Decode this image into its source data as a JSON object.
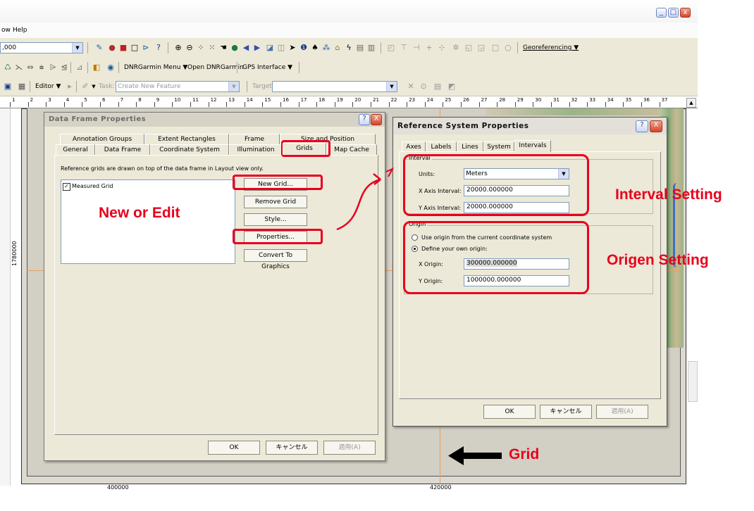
{
  "menu": {
    "items": [
      "ow",
      "Help"
    ]
  },
  "toolbar1": {
    "scale_value": ",000",
    "georeferencing_label": "Georeferencing ▼"
  },
  "toolbar2": {
    "dnr_menu": "DNRGarmin Menu ▼",
    "open_dnr": "Open DNRGarmin",
    "gps_interface": "GPS Interface ▼"
  },
  "toolbar3": {
    "editor_label": "Editor ▼",
    "task_label": "Task:",
    "task_value": "Create New Feature",
    "target_label": "Target:"
  },
  "ruler": {
    "ticks": [
      "1",
      "2",
      "3",
      "4",
      "5",
      "6",
      "7",
      "8",
      "9",
      "10",
      "11",
      "12",
      "13",
      "14",
      "15",
      "16",
      "17",
      "18",
      "19",
      "20",
      "21",
      "22",
      "23",
      "24",
      "25",
      "26",
      "27",
      "28",
      "29",
      "30",
      "31",
      "32",
      "33",
      "34",
      "35",
      "36",
      "37"
    ]
  },
  "map": {
    "y_coord_label": "1780000",
    "x_coord_left": "400000",
    "x_coord_right": "420000"
  },
  "data_frame_dialog": {
    "title": "Data Frame Properties",
    "help_btn": "?",
    "close_btn": "X",
    "tabs_row1": [
      "Annotation Groups",
      "Extent Rectangles",
      "Frame",
      "Size and Position"
    ],
    "tabs_row2": [
      "General",
      "Data Frame",
      "Coordinate System",
      "Illumination",
      "Grids",
      "Map Cache"
    ],
    "description": "Reference grids are drawn on top of the data frame in Layout view only.",
    "grid_list": [
      {
        "label": "Measured Grid",
        "checked": true
      }
    ],
    "buttons": {
      "new_grid": "New Grid...",
      "remove_grid": "Remove Grid",
      "style": "Style...",
      "properties": "Properties...",
      "convert": "Convert To Graphics"
    },
    "footer": {
      "ok": "OK",
      "cancel": "キャンセル",
      "apply": "適用(A)"
    }
  },
  "ref_dialog": {
    "title": "Reference System Properties",
    "help_btn": "?",
    "close_btn": "X",
    "tabs": [
      "Axes",
      "Labels",
      "Lines",
      "System",
      "Intervals"
    ],
    "interval_group": "Interval",
    "units_label": "Units:",
    "units_value": "Meters",
    "x_interval_label": "X Axis Interval:",
    "x_interval_value": "20000.000000",
    "y_interval_label": "Y Axis Interval:",
    "y_interval_value": "20000.000000",
    "origin_group": "Origin",
    "use_origin_label": "Use origin from the current coordinate system",
    "define_origin_label": "Define your own origin:",
    "x_origin_label": "X Origin:",
    "x_origin_value": "300000.000000",
    "y_origin_label": "Y Origin:",
    "y_origin_value": "1000000.000000",
    "footer": {
      "ok": "OK",
      "cancel": "キャンセル",
      "apply": "適用(A)"
    }
  },
  "annotations": {
    "new_or_edit": "New or Edit",
    "interval_setting": "Interval Setting",
    "origin_setting": "Origen Setting",
    "grid": "Grid"
  },
  "colors": {
    "highlight_red": "#e8001c",
    "dialog_bg": "#ece9d8",
    "map_green": "#8bb07c"
  }
}
